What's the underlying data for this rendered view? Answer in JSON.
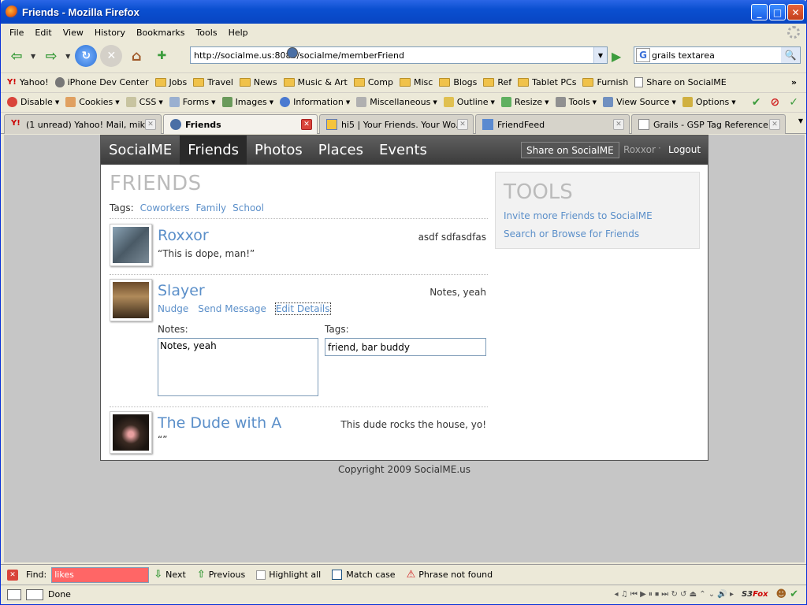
{
  "window": {
    "title": "Friends - Mozilla Firefox"
  },
  "menu": [
    "File",
    "Edit",
    "View",
    "History",
    "Bookmarks",
    "Tools",
    "Help"
  ],
  "nav": {
    "url": "http://socialme.us:8080/socialme/memberFriend",
    "search": "grails textarea"
  },
  "bookmarks": [
    "Yahoo!",
    "iPhone Dev Center",
    "Jobs",
    "Travel",
    "News",
    "Music & Art",
    "Comp",
    "Misc",
    "Blogs",
    "Ref",
    "Tablet PCs",
    "Furnish",
    "Share on SocialME"
  ],
  "devtoolbar": [
    "Disable",
    "Cookies",
    "CSS",
    "Forms",
    "Images",
    "Information",
    "Miscellaneous",
    "Outline",
    "Resize",
    "Tools",
    "View Source",
    "Options"
  ],
  "tabs": [
    {
      "label": "(1 unread) Yahoo! Mail, mik..."
    },
    {
      "label": "Friends"
    },
    {
      "label": "hi5 | Your Friends. Your Wo..."
    },
    {
      "label": "FriendFeed"
    },
    {
      "label": "Grails - GSP Tag Reference"
    }
  ],
  "site": {
    "brand": "SocialME",
    "nav": [
      "Friends",
      "Photos",
      "Places",
      "Events"
    ],
    "share": "Share on SocialME",
    "user": "Roxxor",
    "sep": "·",
    "logout": "Logout",
    "heading": "FRIENDS",
    "tags_label": "Tags:",
    "tags": [
      "Coworkers",
      "Family",
      "School"
    ],
    "friends": [
      {
        "name": "Roxxor",
        "note": "asdf sdfasdfas",
        "quote": "“This is dope, man!”"
      },
      {
        "name": "Slayer",
        "note": "Notes, yeah",
        "actions": [
          "Nudge",
          "Send Message",
          "Edit Details"
        ],
        "notes_label": "Notes:",
        "notes_value": "Notes, yeah",
        "tags_label": "Tags:",
        "tags_value": "friend, bar buddy"
      },
      {
        "name": "The Dude with A",
        "note": "This dude rocks the house, yo!",
        "quote": "“”"
      }
    ],
    "tools": {
      "heading": "TOOLS",
      "links": [
        "Invite more Friends to SocialME",
        "Search or Browse for Friends"
      ]
    },
    "copyright": "Copyright 2009 SocialME.us"
  },
  "find": {
    "label": "Find:",
    "value": "likes",
    "next": "Next",
    "previous": "Previous",
    "highlight": "Highlight all",
    "match": "Match case",
    "status": "Phrase not found"
  },
  "status": {
    "text": "Done",
    "s3fox_a": "S3",
    "s3fox_b": "Fox"
  }
}
